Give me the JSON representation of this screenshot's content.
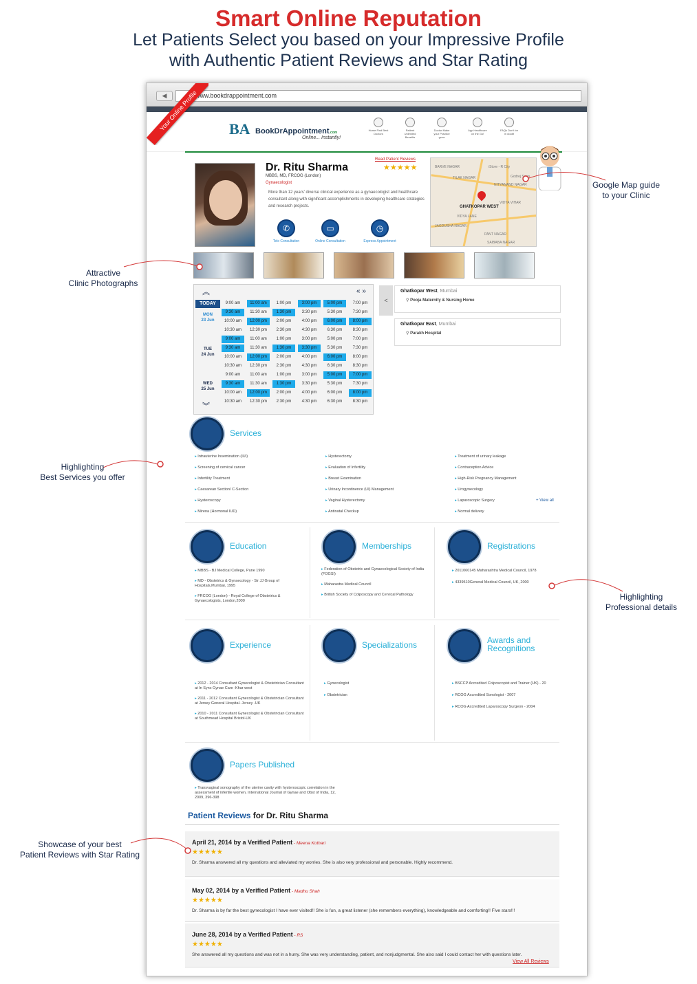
{
  "header": {
    "title": "Smart Online Reputation",
    "subtitle_line1": "Let Patients Select you based on your Impressive Profile",
    "subtitle_line2": "with Authentic Patient Reviews and Star Rating"
  },
  "browser": {
    "url": "www.bookdrappointment.com",
    "ribbon": "Your Online Profile"
  },
  "site": {
    "logo_mark": "BA",
    "logo_text": "BookDrAppointment",
    "logo_suffix": ".com",
    "logo_tagline": "Online... Instantly!",
    "nav": [
      "Home Find Best Doctors",
      "Patient Unlimited Benefits",
      "Doctor Make your Practice grow",
      "App Healthcare on the Go!",
      "FAQs Don't be in doubt"
    ]
  },
  "profile": {
    "name": "Dr. Ritu Sharma",
    "qualifications": "MBBS, MD, FRCOG (London)",
    "specialty": "Gynaecologist",
    "bio": "More than 12 years' diverse clinical experience as a gynaecologist and healthcare consultant along with significant accomplishments in developing healthcare strategies and research projects.",
    "read_reviews": "Read Patient Reviews",
    "stars": "★★★★★",
    "consult": [
      {
        "label": "Tele Consultation",
        "icon": "phone-icon",
        "glyph": "✆"
      },
      {
        "label": "Online Consultation",
        "icon": "monitor-icon",
        "glyph": "▭"
      },
      {
        "label": "Express Appointment",
        "icon": "clock-icon",
        "glyph": "◷"
      }
    ]
  },
  "map": {
    "labels": [
      "BARVE NAGAR",
      "TILAK NAGAR",
      "NITYANAND NAGAR",
      "GHATKOPAR WEST",
      "JAGDUSHA NAGAR",
      "PANT NAGAR",
      "SAIBABA NAGAR",
      "Godrej Soap",
      "VIDYA VIHAR",
      "VIDYA LANE",
      "iStore - R City"
    ],
    "highlight": "GHATKOPAR WEST"
  },
  "schedule": {
    "today": "TODAY",
    "days": [
      {
        "name": "MON",
        "date": "23 Jun"
      },
      {
        "name": "TUE",
        "date": "24 Jun"
      },
      {
        "name": "WED",
        "date": "25 Jun"
      }
    ],
    "times": [
      [
        "9:00 am",
        "11:00 am",
        "1:00 pm",
        "3:00 pm",
        "5:00 pm",
        "7:00 pm"
      ],
      [
        "9:30 am",
        "11:30 am",
        "1:30 pm",
        "3:30 pm",
        "5:30 pm",
        "7:30 pm"
      ],
      [
        "10:00 am",
        "12:00 pm",
        "2:00 pm",
        "4:00 pm",
        "6:00 pm",
        "8:00 pm"
      ],
      [
        "10:30 am",
        "12:30 pm",
        "2:30 pm",
        "4:30 pm",
        "6:30 pm",
        "8:30 pm"
      ]
    ],
    "available": [
      [
        [
          0,
          1,
          0,
          1,
          1,
          0
        ],
        [
          1,
          0,
          1,
          0,
          0,
          0
        ],
        [
          0,
          1,
          0,
          0,
          1,
          1
        ],
        [
          0,
          0,
          0,
          0,
          0,
          0
        ]
      ],
      [
        [
          1,
          0,
          0,
          0,
          0,
          0
        ],
        [
          1,
          0,
          1,
          1,
          0,
          0
        ],
        [
          0,
          1,
          0,
          0,
          1,
          0
        ],
        [
          0,
          0,
          0,
          0,
          0,
          0
        ]
      ],
      [
        [
          0,
          0,
          0,
          0,
          1,
          1
        ],
        [
          1,
          0,
          1,
          0,
          0,
          0
        ],
        [
          0,
          1,
          0,
          0,
          0,
          1
        ],
        [
          0,
          0,
          0,
          0,
          0,
          0
        ]
      ]
    ]
  },
  "locations": [
    {
      "area": "Ghatkopar West",
      "city": ", Mumbai",
      "hospital": "Pooja Maternity & Nursing Home"
    },
    {
      "area": "Ghatkopar East",
      "city": ", Mumbai",
      "hospital": "Parakh Hospital"
    }
  ],
  "services": {
    "title": "Services",
    "columns": [
      [
        "Intrauterine Insemination (IUI)",
        "Screening of cervical cancer",
        "Infertility Treatment",
        "Caesarean Section/ C-Section",
        "Hysteroscopy",
        "Mirena (Hormonal IUD)"
      ],
      [
        "Hysterectomy",
        "Evaluation of Infertility",
        "Breast Examination",
        "Urinary Incontinence (UI) Management",
        "Vaginal Hysterectomy",
        "Antinatal Checkup"
      ],
      [
        "Treatment of urinary leakage",
        "Contraception Advice",
        "High-Risk Pregnancy Management",
        "Urogynecology",
        "Laparoscopic Surgery",
        "Normal delivery"
      ]
    ],
    "view_all": "+ View all"
  },
  "education": {
    "title": "Education",
    "items": [
      "MBBS - BJ Medical College, Pune 1990",
      "MD - Obstetrics & Gynaecology - Sir JJ Group of Hospitals,Mumbai, 1995",
      "FRCOG (London) - Royal College of Obstetrics & Gynaecologists, London,2000"
    ]
  },
  "memberships": {
    "title": "Memberships",
    "items": [
      "Federation of Obstetric and Gynaecological Society of India (FOGSI)",
      "Maharastra Medical Council",
      "British Society of Colposcopy and Cervical Pathology"
    ]
  },
  "registrations": {
    "title": "Registrations",
    "items": [
      "2011060145 Maharashtra Medical Council, 1978",
      "4339510General Medical Council, UK, 2000"
    ]
  },
  "experience": {
    "title": "Experience",
    "items": [
      "2012 - 2014 Consultant Gynecologist & Obstetrician Consultant at In Sync Gynae Care -Khar west",
      "2011 - 2012 Consultant Gynecologist & Obstetrician Consultant at Jersey General Hospital- Jersey -UK",
      "2010 - 2011 Consultant Gynecologist & Obstetrician Consultant at Southmead Hospital Bristol-UK"
    ]
  },
  "specializations": {
    "title": "Specializations",
    "items": [
      "Gynecologist",
      "Obstetrician"
    ]
  },
  "awards": {
    "title_line1": "Awards and",
    "title_line2": "Recognitions",
    "items": [
      "BSCCP Accredited Colposcopist and Trainer (UK) - 20",
      "RCOG Accredited Sonologist - 2007",
      "RCOG Accredited Laparoscopy Surgeon - 2004"
    ]
  },
  "papers": {
    "title": "Papers Published",
    "items": [
      "Transvaginal sonography of the uterine cavity with hysteroscopic correlation in the assessment of infertile women, International Journal of Gynae and Obst of India, 12, 2009, 396-398"
    ]
  },
  "reviews": {
    "heading": "Patient Reviews",
    "heading_suffix": " for Dr. Ritu Sharma",
    "stars": "★★★★★",
    "items": [
      {
        "date": "April 21, 2014 by a Verified Patient",
        "by": " - Meena Kothari",
        "text": "Dr. Sharma answered all my questions and alleviated my worries. She is also very professional and personable. Highly recommend."
      },
      {
        "date": "May 02, 2014 by a Verified Patient",
        "by": " - Madhu Shah",
        "text": "Dr. Sharma is by far the best gynecologist I have ever visited!! She is fun, a great listener (she remembers everything), knowledgeable and comforting!! Five stars!!!"
      },
      {
        "date": "June 28, 2014 by a Verified Patient",
        "by": " - RS",
        "text": "She answered all my questions and was not in a hurry. She was very understanding, patient, and nonjudgmental. She also said I could contact her with questions later."
      }
    ],
    "view_all": "View All Reviews"
  },
  "annotations": {
    "map": [
      "Google Map guide",
      "to your Clinic"
    ],
    "photos": [
      "Attractive",
      "Clinic Photographs"
    ],
    "services": [
      "Highlighting",
      "Best Services you offer"
    ],
    "professional": [
      "Highlighting",
      "Professional details"
    ],
    "reviews": [
      "Showcase of your best",
      "Patient Reviews with Star Rating"
    ]
  }
}
